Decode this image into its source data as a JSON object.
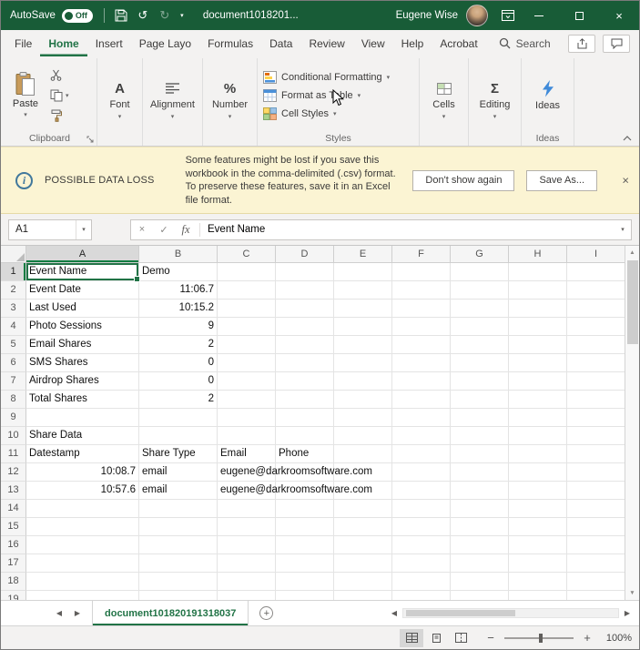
{
  "title_bar": {
    "autosave_label": "AutoSave",
    "autosave_state": "Off",
    "document_title": "document1018201...",
    "user_name": "Eugene Wise"
  },
  "ribbon_tabs": {
    "tabs": [
      "File",
      "Home",
      "Insert",
      "Page Layo",
      "Formulas",
      "Data",
      "Review",
      "View",
      "Help",
      "Acrobat"
    ],
    "active_tab": "Home",
    "search_label": "Search"
  },
  "ribbon": {
    "paste_label": "Paste",
    "clipboard_group_label": "Clipboard",
    "font_symbol": "A",
    "font_group_label": "Font",
    "alignment_group_label": "Alignment",
    "number_symbol": "%",
    "number_group_label": "Number",
    "styles_buttons": [
      "Conditional Formatting",
      "Format as Table",
      "Cell Styles"
    ],
    "styles_group_label": "Styles",
    "cells_group_label": "Cells",
    "editing_symbol": "Σ",
    "editing_group_label": "Editing",
    "ideas_button_label": "Ideas",
    "ideas_group_label": "Ideas"
  },
  "warning_bar": {
    "title": "POSSIBLE DATA LOSS",
    "message": "Some features might be lost if you save this workbook in the comma-delimited (.csv) format. To preserve these features, save it in an Excel file format.",
    "dont_show_button": "Don't show again",
    "save_as_button": "Save As..."
  },
  "formula_bar": {
    "name_box": "A1",
    "content": "Event Name"
  },
  "grid": {
    "columns": [
      "A",
      "B",
      "C",
      "D",
      "E",
      "F",
      "G",
      "H",
      "I"
    ],
    "selected_cell": "A1",
    "rows": [
      {
        "n": 1,
        "cells": [
          {
            "c": "A",
            "t": "Event Name"
          },
          {
            "c": "B",
            "t": "Demo"
          }
        ]
      },
      {
        "n": 2,
        "cells": [
          {
            "c": "A",
            "t": "Event Date"
          },
          {
            "c": "B",
            "t": "11:06.7",
            "a": "r"
          }
        ]
      },
      {
        "n": 3,
        "cells": [
          {
            "c": "A",
            "t": "Last Used"
          },
          {
            "c": "B",
            "t": "10:15.2",
            "a": "r"
          }
        ]
      },
      {
        "n": 4,
        "cells": [
          {
            "c": "A",
            "t": "Photo Sessions"
          },
          {
            "c": "B",
            "t": "9",
            "a": "r"
          }
        ]
      },
      {
        "n": 5,
        "cells": [
          {
            "c": "A",
            "t": "Email Shares"
          },
          {
            "c": "B",
            "t": "2",
            "a": "r"
          }
        ]
      },
      {
        "n": 6,
        "cells": [
          {
            "c": "A",
            "t": "SMS Shares"
          },
          {
            "c": "B",
            "t": "0",
            "a": "r"
          }
        ]
      },
      {
        "n": 7,
        "cells": [
          {
            "c": "A",
            "t": "Airdrop Shares"
          },
          {
            "c": "B",
            "t": "0",
            "a": "r"
          }
        ]
      },
      {
        "n": 8,
        "cells": [
          {
            "c": "A",
            "t": "Total Shares"
          },
          {
            "c": "B",
            "t": "2",
            "a": "r"
          }
        ]
      },
      {
        "n": 9,
        "cells": []
      },
      {
        "n": 10,
        "cells": [
          {
            "c": "A",
            "t": "Share Data"
          }
        ]
      },
      {
        "n": 11,
        "cells": [
          {
            "c": "A",
            "t": "Datestamp"
          },
          {
            "c": "B",
            "t": "Share Type"
          },
          {
            "c": "C",
            "t": "Email"
          },
          {
            "c": "D",
            "t": "Phone"
          }
        ]
      },
      {
        "n": 12,
        "cells": [
          {
            "c": "A",
            "t": "10:08.7",
            "a": "r"
          },
          {
            "c": "B",
            "t": "email"
          },
          {
            "c": "C",
            "t": "eugene@darkroomsoftware.com",
            "o": true
          }
        ]
      },
      {
        "n": 13,
        "cells": [
          {
            "c": "A",
            "t": "10:57.6",
            "a": "r"
          },
          {
            "c": "B",
            "t": "email"
          },
          {
            "c": "C",
            "t": "eugene@darkroomsoftware.com",
            "o": true
          }
        ]
      },
      {
        "n": 14,
        "cells": []
      },
      {
        "n": 15,
        "cells": []
      },
      {
        "n": 16,
        "cells": []
      },
      {
        "n": 17,
        "cells": []
      },
      {
        "n": 18,
        "cells": []
      },
      {
        "n": 19,
        "cells": []
      }
    ]
  },
  "sheet_bar": {
    "tab_name": "document101820191318037"
  },
  "status_bar": {
    "zoom": "100%"
  },
  "icons": {
    "undo": "↺",
    "redo": "↻",
    "caret": "▾",
    "cancel": "×",
    "enter": "✓",
    "fx": "fx",
    "close": "×",
    "prev": "◀",
    "next": "▶",
    "up": "▲",
    "down": "▼",
    "add": "+",
    "zoom_out": "−",
    "zoom_in": "+",
    "info": "i"
  },
  "colors": {
    "titlebar": "#185C37",
    "accent": "#217346",
    "warning_bg": "#FBF4D3"
  }
}
